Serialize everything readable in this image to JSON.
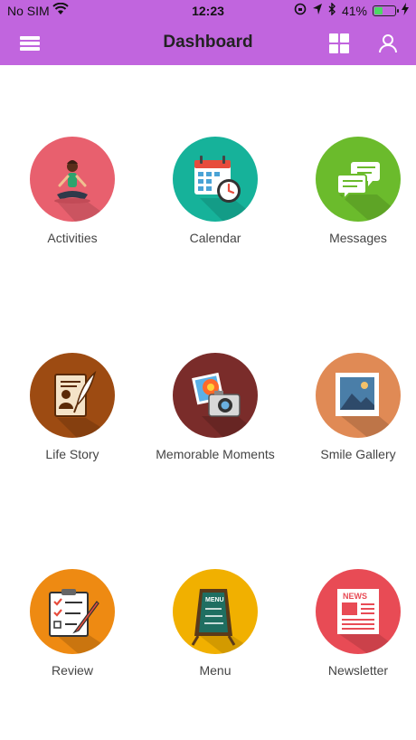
{
  "status_bar": {
    "carrier": "No SIM",
    "time": "12:23",
    "battery": "41%",
    "battery_level": 0.41
  },
  "header": {
    "title": "Dashboard",
    "icons": [
      "menu-icon",
      "grid-view-icon",
      "user-profile-icon"
    ]
  },
  "tiles": [
    {
      "label": "Activities",
      "color": "#e8606e",
      "icon": "yoga-person-icon"
    },
    {
      "label": "Calendar",
      "color": "#16b29a",
      "icon": "calendar-clock-icon"
    },
    {
      "label": "Messages",
      "color": "#6bbb2c",
      "icon": "chat-bubbles-icon"
    },
    {
      "label": "Life Story",
      "color": "#9d4b12",
      "icon": "document-quill-icon"
    },
    {
      "label": "Memorable Moments",
      "color": "#7a2c2a",
      "icon": "camera-photos-icon"
    },
    {
      "label": "Smile Gallery",
      "color": "#e08a55",
      "icon": "picture-frame-icon"
    },
    {
      "label": "Review",
      "color": "#ee8a12",
      "icon": "clipboard-checklist-icon"
    },
    {
      "label": "Menu",
      "color": "#f1b000",
      "icon": "menu-board-icon"
    },
    {
      "label": "Newsletter",
      "color": "#e84b55",
      "icon": "newspaper-icon"
    }
  ]
}
